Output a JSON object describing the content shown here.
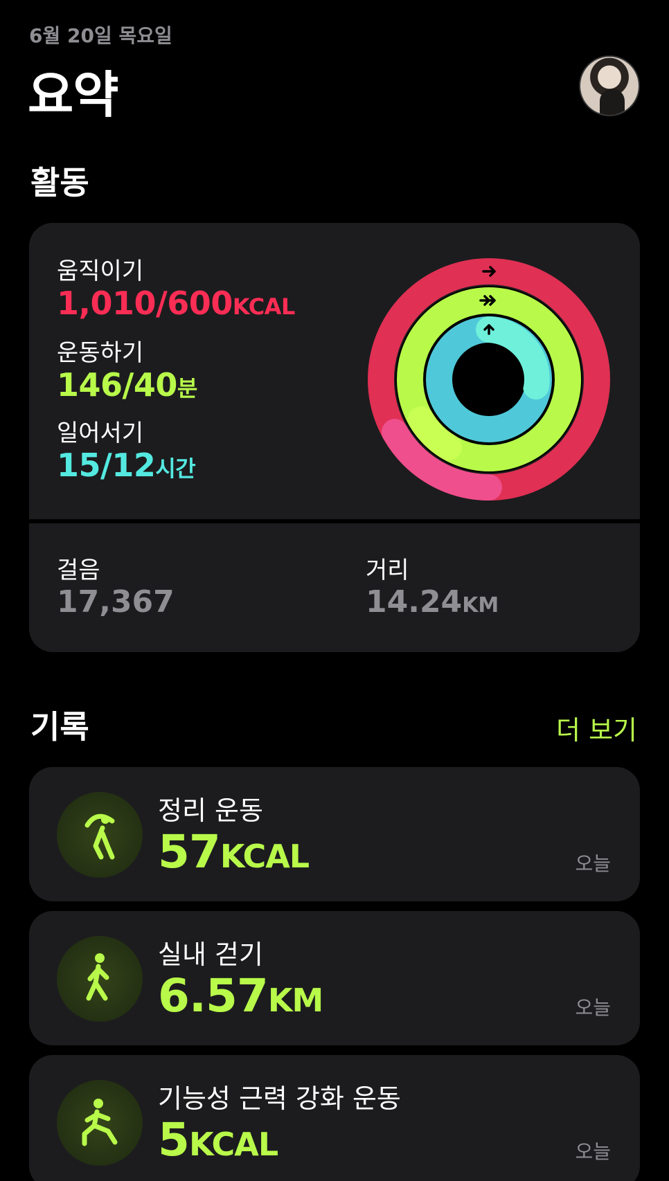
{
  "header": {
    "date": "6월 20일 목요일",
    "title": "요약"
  },
  "activity": {
    "heading": "활동",
    "move": {
      "label": "움직이기",
      "value": "1,010/600",
      "unit": "KCAL",
      "color": "#fa2d55",
      "progress": 1.683
    },
    "exercise": {
      "label": "운동하기",
      "value": "146/40",
      "unit": "분",
      "color": "#b8f94a",
      "progress": 3.65
    },
    "stand": {
      "label": "일어서기",
      "value": "15/12",
      "unit": "시간",
      "color": "#54e9e0",
      "progress": 1.25
    },
    "steps": {
      "label": "걸음",
      "value": "17,367"
    },
    "distance": {
      "label": "거리",
      "value": "14.24",
      "unit": "KM"
    }
  },
  "history": {
    "heading": "기록",
    "more": "더 보기",
    "items": [
      {
        "name": "정리 운동",
        "value": "57",
        "unit": "KCAL",
        "when": "오늘",
        "icon": "stretch-icon"
      },
      {
        "name": "실내 걷기",
        "value": "6.57",
        "unit": "KM",
        "when": "오늘",
        "icon": "walking-icon"
      },
      {
        "name": "기능성 근력 강화 운동",
        "value": "5",
        "unit": "KCAL",
        "when": "오늘",
        "icon": "strength-icon"
      }
    ]
  }
}
